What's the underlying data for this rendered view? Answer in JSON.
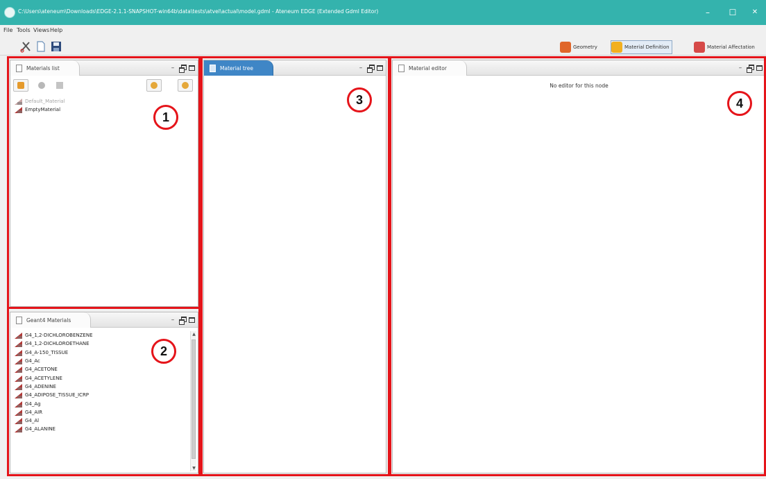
{
  "window": {
    "title": "C:\\Users\\ateneum\\Downloads\\EDGE-2.1.1-SNAPSHOT-win64b\\data\\tests\\atvel\\actual\\model.gdml - Ateneum EDGE (Extended Gdml Editor)",
    "minimize": "–",
    "maximize": "☐",
    "close": "✕"
  },
  "menu": [
    "File",
    "Tools",
    "Views",
    "Help"
  ],
  "perspectives": [
    {
      "label": "Geometry",
      "icon": "geometry-icon",
      "color": "#e0662a"
    },
    {
      "label": "Material Definition",
      "icon": "material-definition-icon",
      "color": "#f2b020",
      "active": true
    },
    {
      "label": "Material Affectation",
      "icon": "material-affectation-icon",
      "color": "#d64a48"
    }
  ],
  "materials_list": {
    "title": "Materials list",
    "items": [
      {
        "label": "Default_Material",
        "disabled": true
      },
      {
        "label": "EmptyMaterial",
        "disabled": false
      }
    ]
  },
  "geant4_materials": {
    "title": "Geant4 Materials",
    "items": [
      "G4_1,2-DICHLOROBENZENE",
      "G4_1,2-DICHLOROETHANE",
      "G4_A-150_TISSUE",
      "G4_Ac",
      "G4_ACETONE",
      "G4_ACETYLENE",
      "G4_ADENINE",
      "G4_ADIPOSE_TISSUE_ICRP",
      "G4_Ag",
      "G4_AIR",
      "G4_Al",
      "G4_ALANINE"
    ]
  },
  "material_tree": {
    "title": "Material tree"
  },
  "material_editor": {
    "title": "Material editor",
    "empty_message": "No editor for this node"
  },
  "panel_controls": {
    "minimize": "–"
  },
  "annotations": [
    "1",
    "2",
    "3",
    "4"
  ],
  "colors": {
    "titlebar": "#34b3ad",
    "active_tab": "#3f86c6",
    "annotation": "#e5141a"
  }
}
